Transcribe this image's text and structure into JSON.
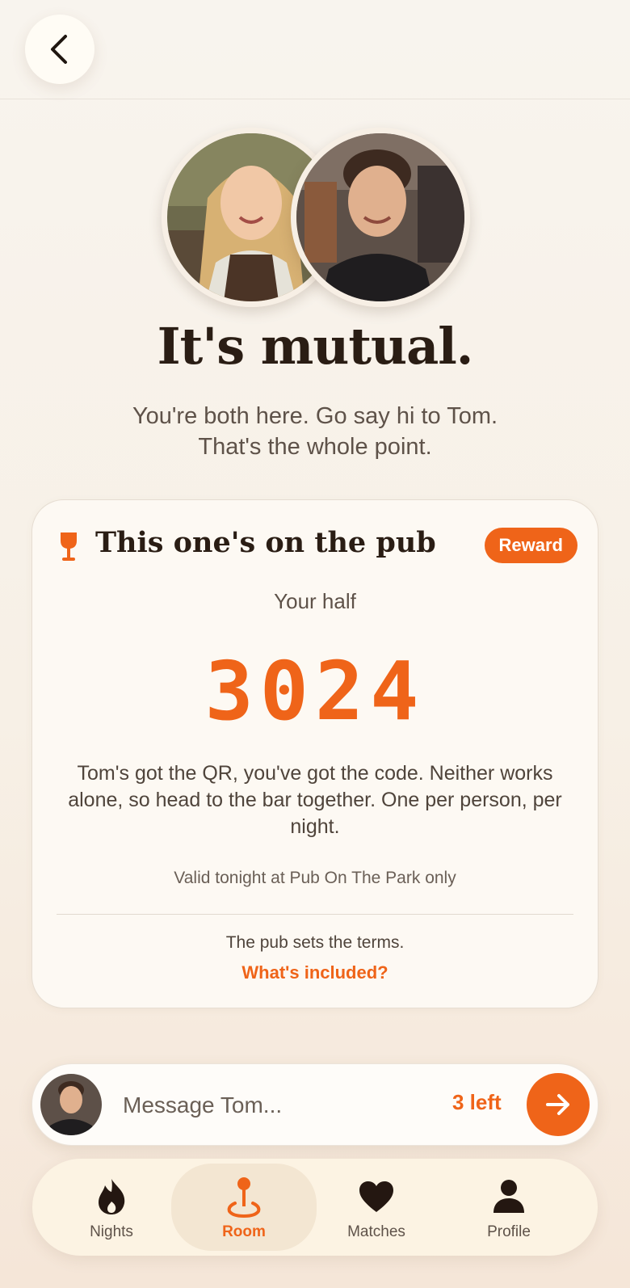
{
  "header": {
    "back_label": "Back"
  },
  "hero": {
    "title": "It's mutual.",
    "subtitle_line1": "You're both here. Go say hi to Tom.",
    "subtitle_line2": "That's the whole point."
  },
  "reward_card": {
    "title": "This one's on the pub",
    "badge": "Reward",
    "your_half_label": "Your half",
    "code": "3024",
    "explanation": "Tom's got the QR, you've got the code. Neither works alone, so head to the bar together. One per person, per night.",
    "validity": "Valid tonight at Pub On The Park only",
    "terms": "The pub sets the terms.",
    "included_link": "What's included?"
  },
  "message_bar": {
    "placeholder": "Message Tom...",
    "remaining": "3 left"
  },
  "tabs": [
    {
      "label": "Nights",
      "icon": "flame-icon",
      "active": false
    },
    {
      "label": "Room",
      "icon": "location-pin-icon",
      "active": true
    },
    {
      "label": "Matches",
      "icon": "heart-icon",
      "active": false
    },
    {
      "label": "Profile",
      "icon": "person-icon",
      "active": false
    }
  ],
  "colors": {
    "accent": "#ef6419",
    "background": "#f8f4ee",
    "text": "#2a1d14"
  }
}
